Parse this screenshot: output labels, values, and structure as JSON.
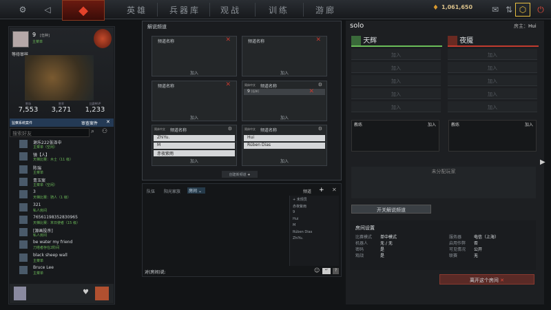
{
  "nav": {
    "tabs": [
      "英雄",
      "兵器库",
      "观战",
      "训练",
      "游廊"
    ]
  },
  "currency": "1,061,650",
  "profile": {
    "name": "9",
    "tag": "[伍种]",
    "status": "主菜单",
    "wait": "等待审核...",
    "stats": [
      {
        "label": "胜场",
        "value": "7,553"
      },
      {
        "label": "胜率",
        "value": "3,271"
      },
      {
        "label": "比赛MVP",
        "value": "1,233"
      }
    ]
  },
  "friends_bar": "监察系统案件",
  "friends_btn": "审查案件",
  "search_placeholder": "搜索好友",
  "friends": [
    {
      "name": "谢乐222张泽中",
      "status": "主菜单（空闲）"
    },
    {
      "name": "镜【人】",
      "status": "天梯比赛：木士（11 级）"
    },
    {
      "name": "陈瑞",
      "status": "主菜单"
    },
    {
      "name": "青玉案",
      "status": "主菜单（空闲）"
    },
    {
      "name": "3",
      "status": "天梯比赛：骑人（1 级）"
    },
    {
      "name": "321",
      "status": "私人房间"
    },
    {
      "name": "76561198352830965",
      "status": "天梯比赛：末日使者（15 级）"
    },
    {
      "name": "[源画投杀]",
      "status": "私人房间"
    },
    {
      "name": "be water my friend",
      "status": "刀塔者存在2阶间"
    },
    {
      "name": "black sheep wall",
      "status": "主菜单"
    },
    {
      "name": "Bruce Lee",
      "status": "主菜单"
    }
  ],
  "casters": {
    "title": "解说频道",
    "slot_label": "频道名称",
    "join": "加入",
    "lang": "简体中文",
    "owner": "9",
    "owner_tag": "[伍种]",
    "create": "创建新频道",
    "rows_a": [
      "ZhiYu.",
      "M",
      "赤夜紫雨"
    ],
    "rows_b": [
      "Hui",
      "Rúben Dias"
    ]
  },
  "chat": {
    "tabs": [
      "队伍",
      "阳光家族",
      "房间"
    ],
    "label": "频道",
    "input_label": "对(房间)说:",
    "members": [
      "+ 未规员",
      "赤夜紫雨",
      "9",
      "Hui",
      "M",
      "Rúben Dias",
      "ZhiYu."
    ]
  },
  "lobby": {
    "name": "solo",
    "host_label": "房主：",
    "host": "Hui",
    "radiant": "天辉",
    "dire": "夜魇",
    "join": "加入",
    "coach": "教练",
    "unassigned": "未分配玩家",
    "open_caster": "开关解说频道",
    "settings_title": "房间设置",
    "leave": "离开这个房间",
    "settings": [
      [
        "比赛模式",
        "单中模式"
      ],
      [
        "机器人",
        "无 / 无"
      ],
      [
        "密码",
        "是"
      ],
      [
        "观战",
        "是"
      ],
      [
        "服务器",
        "电信（上海）"
      ],
      [
        "启用作弊",
        "否"
      ],
      [
        "可见情况",
        "公开"
      ],
      [
        "联赛",
        "无"
      ]
    ]
  },
  "colors": {
    "accent": "#c03a30",
    "radiant": "#6cbf5a",
    "dire": "#c23b2e"
  }
}
